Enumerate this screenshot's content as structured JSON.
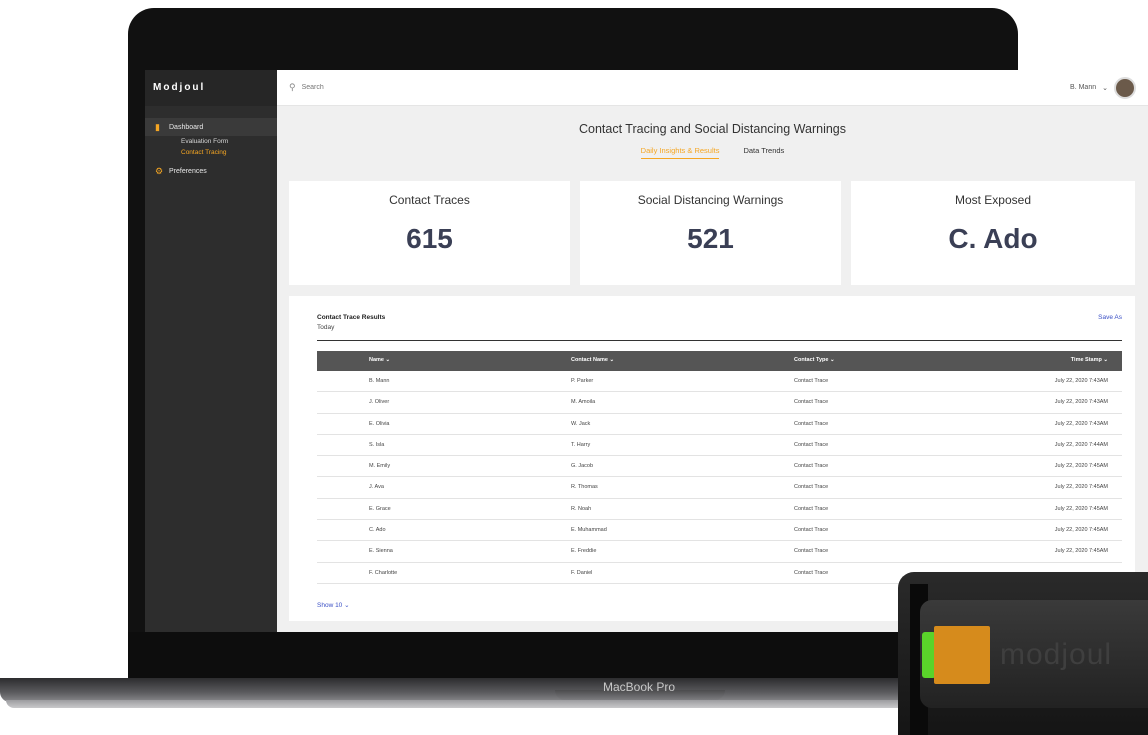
{
  "app": {
    "brand": "Modjoul"
  },
  "laptop": {
    "model_label": "MacBook Pro"
  },
  "device": {
    "label": "modjoul"
  },
  "sidebar": {
    "items": [
      {
        "label": "Dashboard",
        "icon": "bar-chart-icon"
      },
      {
        "label": "Preferences",
        "icon": "gear-icon"
      }
    ],
    "sub_items": [
      {
        "label": "Evaluation Form"
      },
      {
        "label": "Contact Tracing"
      }
    ]
  },
  "topbar": {
    "search_placeholder": "Search",
    "user_name": "B. Mann"
  },
  "page": {
    "title": "Contact Tracing and Social Distancing Warnings",
    "tabs": [
      {
        "label": "Daily Insights & Results"
      },
      {
        "label": "Data Trends"
      }
    ]
  },
  "cards": [
    {
      "label": "Contact Traces",
      "value": "615"
    },
    {
      "label": "Social Distancing Warnings",
      "value": "521"
    },
    {
      "label": "Most Exposed",
      "value": "C. Ado"
    }
  ],
  "results": {
    "title": "Contact Trace Results",
    "subtitle": "Today",
    "save_as": "Save As",
    "show_more": "Show 10",
    "columns": [
      "Name",
      "Contact Name",
      "Contact Type",
      "Time Stamp"
    ],
    "rows": [
      {
        "name": "B. Mann",
        "contact": "P. Parker",
        "type": "Contact Trace",
        "time": "July 22, 2020 7:43AM"
      },
      {
        "name": "J. Oliver",
        "contact": "M. Amoila",
        "type": "Contact Trace",
        "time": "July 22, 2020 7:43AM"
      },
      {
        "name": "E. Olivia",
        "contact": "W. Jack",
        "type": "Contact Trace",
        "time": "July 22, 2020 7:43AM"
      },
      {
        "name": "S. Isla",
        "contact": "T. Harry",
        "type": "Contact Trace",
        "time": "July 22, 2020 7:44AM"
      },
      {
        "name": "M. Emily",
        "contact": "G. Jacob",
        "type": "Contact Trace",
        "time": "July 22, 2020 7:45AM"
      },
      {
        "name": "J. Ava",
        "contact": "R. Thomas",
        "type": "Contact Trace",
        "time": "July 22, 2020 7:45AM"
      },
      {
        "name": "E. Grace",
        "contact": "R. Noah",
        "type": "Contact Trace",
        "time": "July 22, 2020 7:45AM"
      },
      {
        "name": "C. Ado",
        "contact": "E. Muhammad",
        "type": "Contact Trace",
        "time": "July 22, 2020 7:45AM"
      },
      {
        "name": "E. Sienna",
        "contact": "E. Freddie",
        "type": "Contact Trace",
        "time": "July 22, 2020 7:45AM"
      },
      {
        "name": "F. Charlotte",
        "contact": "F. Daniel",
        "type": "Contact Trace",
        "time": ""
      }
    ]
  }
}
